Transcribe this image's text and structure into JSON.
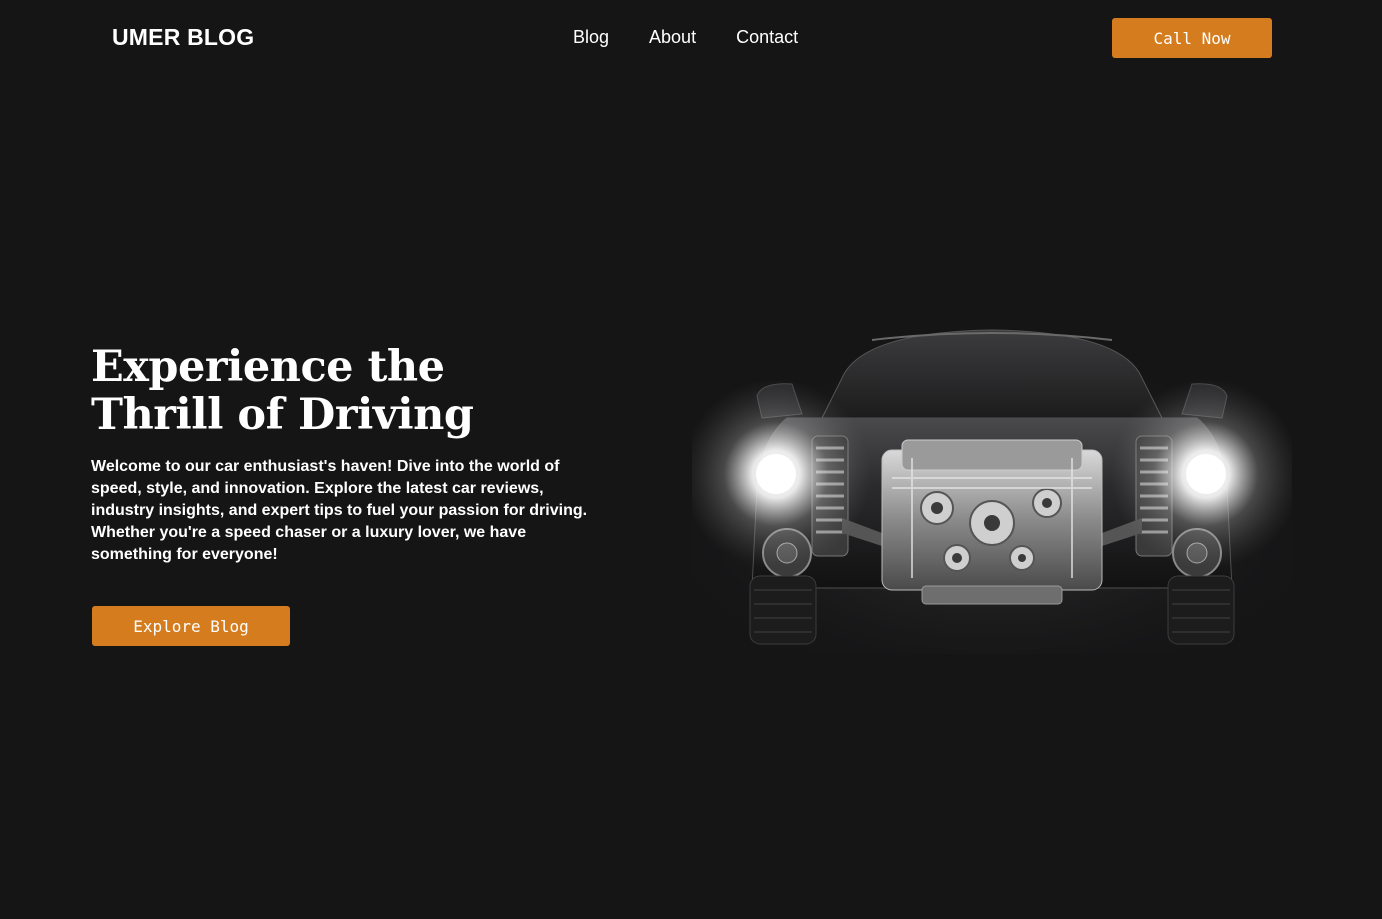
{
  "header": {
    "logo": "UMER BLOG",
    "nav": [
      {
        "label": "Blog"
      },
      {
        "label": "About"
      },
      {
        "label": "Contact"
      }
    ],
    "cta_label": "Call Now"
  },
  "hero": {
    "title_line1": "Experience the",
    "title_line2": "Thrill of Driving",
    "description": "Welcome to our car enthusiast's haven! Dive into the world of speed, style, and innovation. Explore the latest car reviews, industry insights, and expert tips to fuel your passion for driving. Whether you're a speed chaser or a luxury lover, we have something for everyone!",
    "button_label": "Explore Blog"
  },
  "colors": {
    "background": "#151516",
    "accent": "#d47c1e",
    "text": "#ffffff"
  }
}
